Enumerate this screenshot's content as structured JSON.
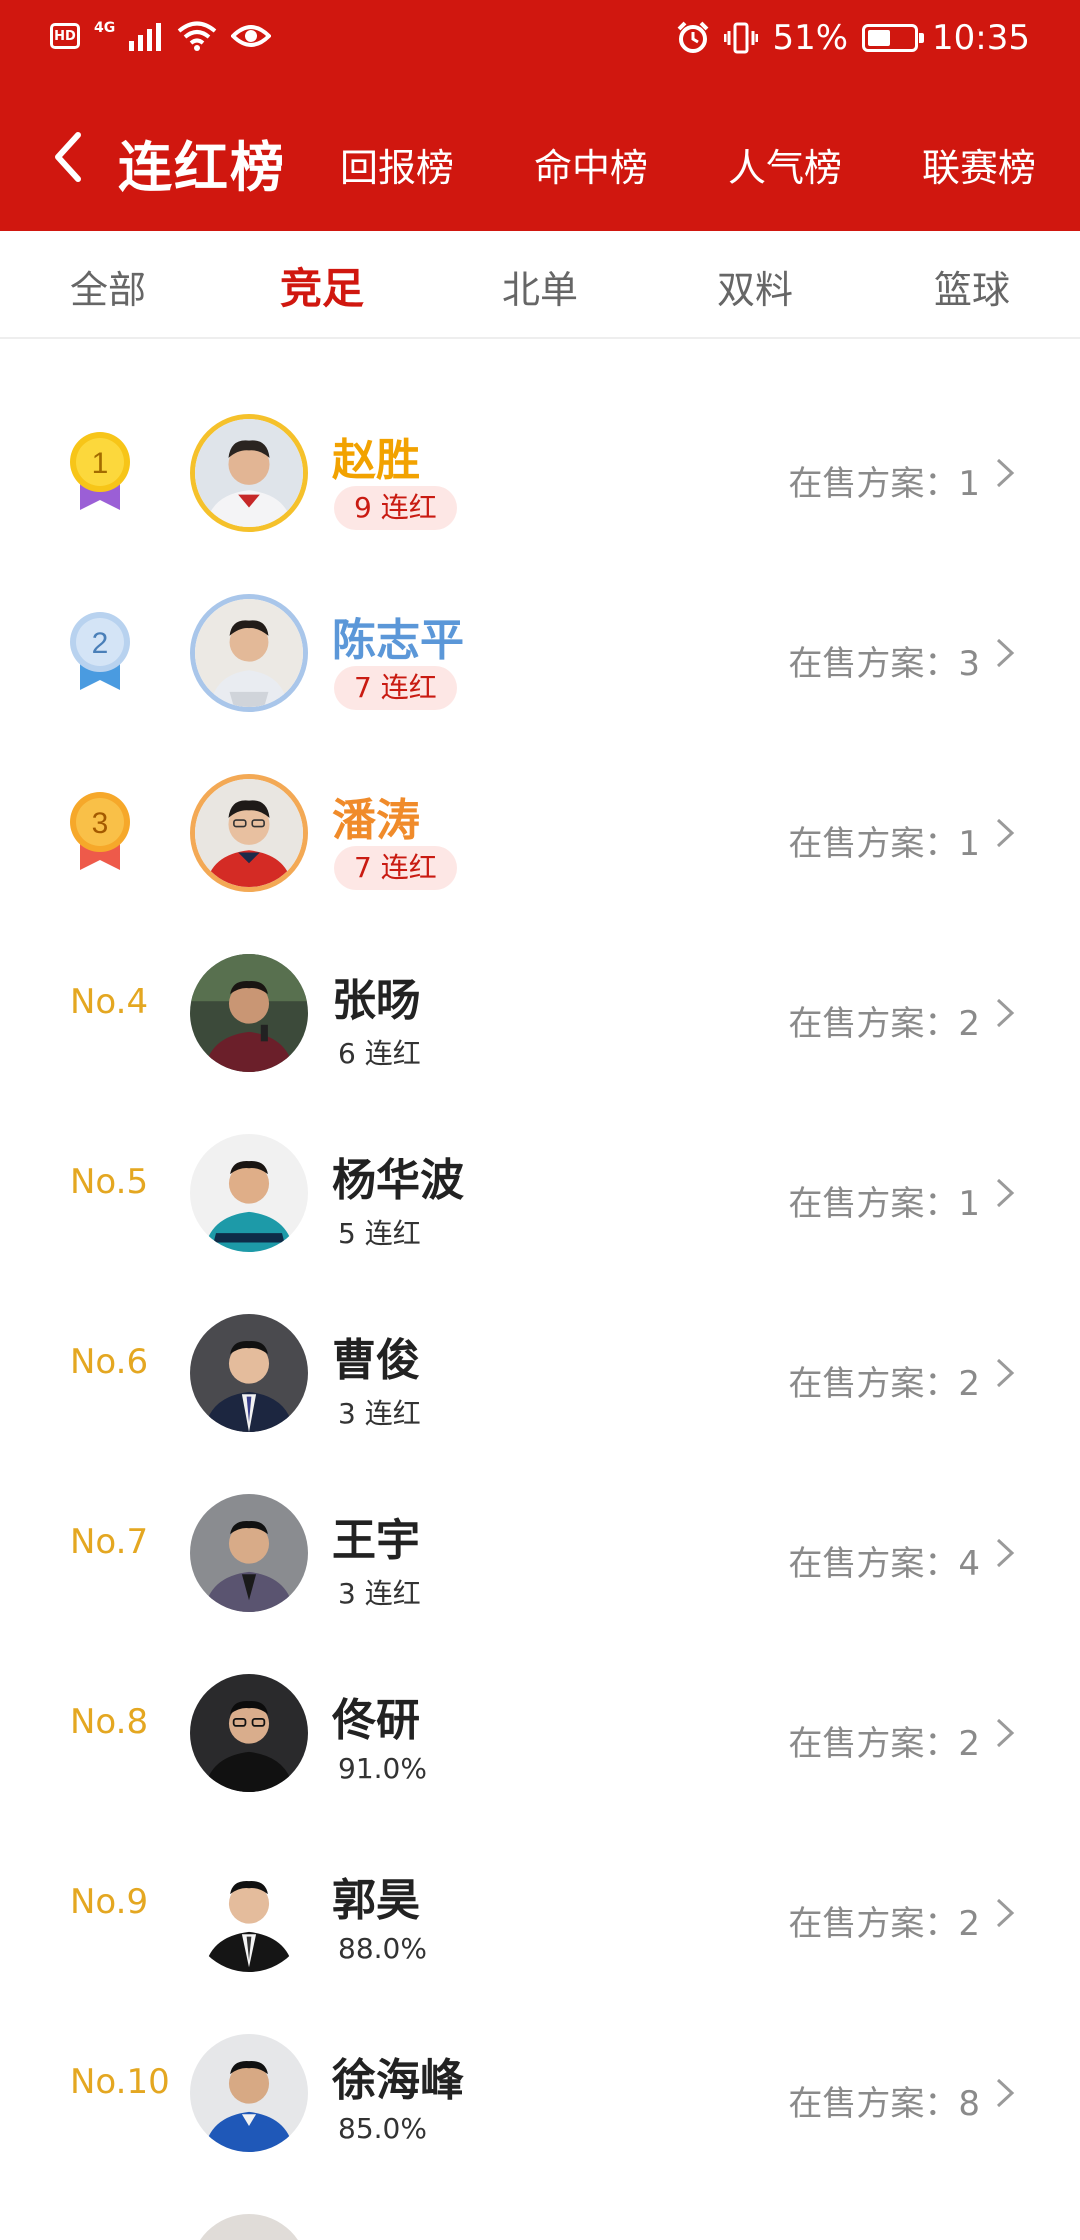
{
  "status_bar": {
    "hd": "HD",
    "network": "4G",
    "battery": "51%",
    "battery_level": 0.51,
    "time": "10:35"
  },
  "nav": {
    "title": "连红榜",
    "tabs": [
      "回报榜",
      "命中榜",
      "人气榜",
      "联赛榜"
    ]
  },
  "categories": {
    "tabs": [
      "全部",
      "竞足",
      "北单",
      "双料",
      "篮球"
    ],
    "active": "竞足"
  },
  "colors": {
    "header_red": "#d0170f",
    "rank_gold": "#e4a721",
    "badge_bg": "#fde7e5",
    "badge_text": "#c91b12"
  },
  "list": [
    {
      "rank": "1",
      "name": "赵胜",
      "streak": "9 连红",
      "plans_label": "在售方案：",
      "plans": "1"
    },
    {
      "rank": "2",
      "name": "陈志平",
      "streak": "7 连红",
      "plans_label": "在售方案：",
      "plans": "3"
    },
    {
      "rank": "3",
      "name": "潘涛",
      "streak": "7 连红",
      "plans_label": "在售方案：",
      "plans": "1"
    },
    {
      "rank": "No.4",
      "name": "张旸",
      "stat": "6 连红",
      "plans_label": "在售方案：",
      "plans": "2"
    },
    {
      "rank": "No.5",
      "name": "杨华波",
      "stat": "5 连红",
      "plans_label": "在售方案：",
      "plans": "1"
    },
    {
      "rank": "No.6",
      "name": "曹俊",
      "stat": "3 连红",
      "plans_label": "在售方案：",
      "plans": "2"
    },
    {
      "rank": "No.7",
      "name": "王宇",
      "stat": "3 连红",
      "plans_label": "在售方案：",
      "plans": "4"
    },
    {
      "rank": "No.8",
      "name": "佟研",
      "stat": "91.0%",
      "plans_label": "在售方案：",
      "plans": "2"
    },
    {
      "rank": "No.9",
      "name": "郭昊",
      "stat": "88.0%",
      "plans_label": "在售方案：",
      "plans": "2"
    },
    {
      "rank": "No.10",
      "name": "徐海峰",
      "stat": "85.0%",
      "plans_label": "在售方案：",
      "plans": "8"
    }
  ]
}
